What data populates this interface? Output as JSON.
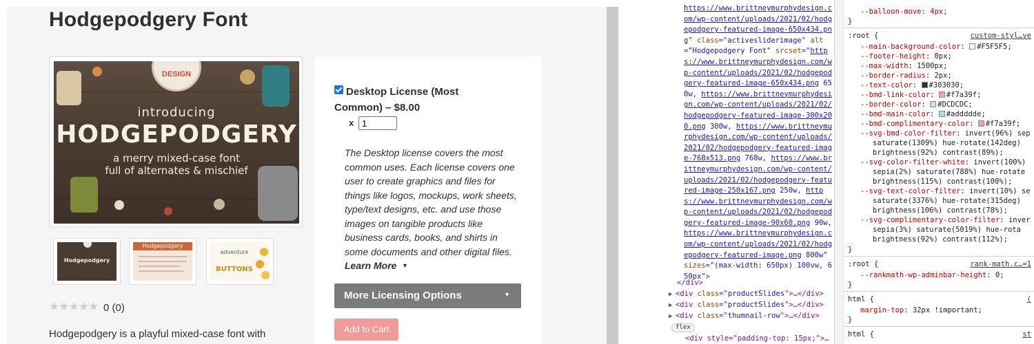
{
  "product": {
    "title": "Hodgepodgery Font",
    "image": {
      "badge_text": "DESIGN",
      "line1": "introducing",
      "line2": "HODGEPODGERY",
      "line3": "a merry mixed-case font",
      "line4": "full of alternates & mischief"
    },
    "thumbnails": [
      {
        "text": "Hodgepodgery"
      },
      {
        "text": "Hodgepodgery"
      },
      {
        "text": "adventure",
        "sub": "BUTTONS"
      }
    ],
    "rating": {
      "stars": "★★★★★",
      "count_text": "0 (0)"
    },
    "description_snippet": "Hodgepodgery is a playful mixed-case font with"
  },
  "license": {
    "option_label": "Desktop License (Most Common) – $8.00",
    "qty_prefix": "x",
    "qty_value": "1",
    "description": "The Desktop license covers the most common uses. Each license covers one user to create graphics and files for things like logos, mockups, work sheets, type/text designs, etc. and use those images on tangible products like business cards, books, and shirts in some documents and other digital files.",
    "learn_more": "Learn More",
    "more_options": "More Licensing Options",
    "add_to_cart": "Add to Cart"
  },
  "devtools": {
    "elements": {
      "src_url": "https://www.brittneymurphydesign.com/wp-content/uploads/2021/02/hodgepodgery-featured-image-650x434.png",
      "class_name": "class",
      "class_value": "activesliderimage",
      "alt_name": "alt",
      "alt_value": "Hodgepodgery Font",
      "srcset_name": "srcset",
      "srcset": [
        {
          "url": "https://www.brittneymurphydesign.com/wp-content/uploads/2021/02/hodgepodgery-featured-image-650x434.png",
          "w": "650w,"
        },
        {
          "url": "https://www.brittneymurphydesign.com/wp-content/uploads/2021/02/hodgepodgery-featured-image-300x200.png",
          "w": "300w,"
        },
        {
          "url": "https://www.brittneymurphydesign.com/wp-content/uploads/2021/02/hodgepodgery-featured-image-768x513.png",
          "w": "768w,"
        },
        {
          "url": "https://www.brittneymurphydesign.com/wp-content/uploads/2021/02/hodgepodgery-featured-image-250x167.png",
          "w": "250w,"
        },
        {
          "url": "https://www.brittneymurphydesign.com/wp-content/uploads/2021/02/hodgepodgery-featured-image-90x60.png",
          "w": "90w,"
        },
        {
          "url": "https://www.brittneymurphydesign.com/wp-content/uploads/2021/02/hodgepodgery-featured-image.png",
          "w": "800w"
        }
      ],
      "sizes_name": "sizes",
      "sizes_value": "(max-width: 650px) 100vw, 650px",
      "close_div": "</div>",
      "rows": [
        {
          "tri": "▶",
          "tag_open": "<div ",
          "attr": "class",
          "val": "productSlides",
          "rest": ">…</div>"
        },
        {
          "tri": "▶",
          "tag_open": "<div ",
          "attr": "class",
          "val": "productSlides",
          "rest": ">…</div>"
        },
        {
          "tri": "▶",
          "tag_open": "<div ",
          "attr": "class",
          "val": "thumnail-row",
          "rest": ">…</div>"
        }
      ],
      "flex_badge": "flex",
      "cutoff_text": "<div style=\"padding-top: 15px;\">…"
    },
    "styles": {
      "balloon_line": "--balloon-move: 4px;",
      "close_brace": "}",
      "root_rule": {
        "selector": ":root {",
        "source": "custom-styl…ve",
        "props": [
          {
            "name": "--main-background-color",
            "value": "#F5F5F5;",
            "swatch": "#F5F5F5"
          },
          {
            "name": "--footer-height",
            "value": "0px;"
          },
          {
            "name": "--max-width",
            "value": "1500px;"
          },
          {
            "name": "--border-radius",
            "value": "2px;"
          },
          {
            "name": "--text-color",
            "value": "#303030;",
            "swatch": "#303030"
          },
          {
            "name": "--bmd-link-color",
            "value": "#f7a39f;",
            "swatch": "#f7a39f"
          },
          {
            "name": "--border-color",
            "value": "#DCDCDC;",
            "swatch": "#DCDCDC"
          },
          {
            "name": "--bmd-main-color",
            "value": "#addddde;",
            "swatch": "#addddd"
          },
          {
            "name": "--bmd-complimentary-color",
            "value": "#f7a39f;",
            "swatch": "#f7a39f"
          }
        ],
        "filters": [
          {
            "name": "--svg-bmd-color-filter",
            "lines": [
              "invert(96%) sep",
              "saturate(1309%) hue-rotate(142deg)",
              "brightness(92%) contrast(89%);"
            ]
          },
          {
            "name": "--svg-color-filter-white",
            "lines": [
              "invert(100%)",
              "sepia(2%) saturate(788%) hue-rotate",
              "brightness(115%) contrast(100%);"
            ]
          },
          {
            "name": "--svg-text-color-filter",
            "lines": [
              "invert(10%) se",
              "saturate(3376%) hue-rotate(315deg)",
              "brightness(106%) contrast(78%);"
            ]
          },
          {
            "name": "--svg-complimentary-color-filter",
            "lines": [
              "inver",
              "sepia(3%) saturate(5019%) hue-rota",
              "brightness(92%) contrast(112%);"
            ]
          }
        ]
      },
      "rankmath_rule": {
        "selector": ":root {",
        "source": "rank-math.c…=1",
        "prop_name": "--rankmath-wp-adminbar-height",
        "prop_value": "0;"
      },
      "html_rule": {
        "selector": "html {",
        "source": "(",
        "prop_name": "margin-top",
        "prop_value": "32px !important;"
      },
      "html_rule2": {
        "selector": "html {",
        "source": "st"
      }
    }
  },
  "colors": {
    "accent_link": "#f7a39f",
    "checkbox": "#1a73e8",
    "add_to_cart_bg": "#f19a9a",
    "more_options_bg": "#7b7b7b"
  }
}
